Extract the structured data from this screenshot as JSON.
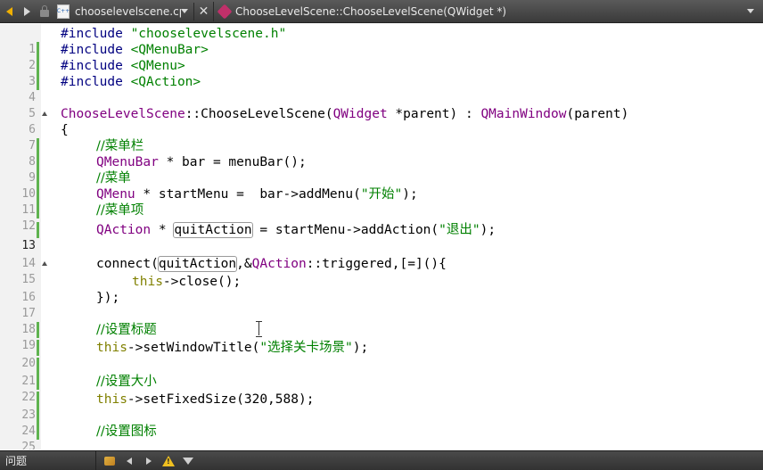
{
  "toolbar": {
    "file_name": "chooselevelscene.cpp",
    "symbol": "ChooseLevelScene::ChooseLevelScene(QWidget *)",
    "close_glyph": "✕",
    "file_icon_text": "C++"
  },
  "bottom_panel": {
    "title": "问题",
    "warning_glyph": "!"
  },
  "editor": {
    "current_line": 13,
    "lines": [
      {
        "n": "1"
      },
      {
        "n": "2"
      },
      {
        "n": "3"
      },
      {
        "n": "4"
      },
      {
        "n": "5"
      },
      {
        "n": "6"
      },
      {
        "n": "7"
      },
      {
        "n": "8"
      },
      {
        "n": "9"
      },
      {
        "n": "10"
      },
      {
        "n": "11"
      },
      {
        "n": "12"
      },
      {
        "n": "13"
      },
      {
        "n": "14"
      },
      {
        "n": "15"
      },
      {
        "n": "16"
      },
      {
        "n": "17"
      },
      {
        "n": "18"
      },
      {
        "n": "19"
      },
      {
        "n": "20"
      },
      {
        "n": "21"
      },
      {
        "n": "22"
      },
      {
        "n": "23"
      },
      {
        "n": "24"
      },
      {
        "n": "25"
      }
    ],
    "code": {
      "l1_a": "#include ",
      "l1_b": "\"chooselevelscene.h\"",
      "l2_a": "#include ",
      "l2_b": "<QMenuBar>",
      "l3_a": "#include ",
      "l3_b": "<QMenu>",
      "l4_a": "#include ",
      "l4_b": "<QAction>",
      "l6_a": "ChooseLevelScene",
      "l6_b": "::ChooseLevelScene(",
      "l6_c": "QWidget",
      "l6_d": " *parent) : ",
      "l6_e": "QMainWindow",
      "l6_f": "(parent)",
      "l7": "{",
      "l8": "//菜单栏",
      "l9_a": "QMenuBar",
      "l9_b": " * bar = menuBar();",
      "l10": "//菜单",
      "l11_a": "QMenu",
      "l11_b": " * startMenu =  bar->addMenu(",
      "l11_c": "\"开始\"",
      "l11_d": ");",
      "l12": "//菜单项",
      "l13_a": "QAction",
      "l13_b": " * ",
      "l13_c": "quitAction",
      "l13_d": " = startMenu->addAction(",
      "l13_e": "\"退出\"",
      "l13_f": ");",
      "l15_a": "connect(",
      "l15_b": "quitAction",
      "l15_c": ",&",
      "l15_d": "QAction",
      "l15_e": "::triggered,[=](){",
      "l16_a": "this",
      "l16_b": "->close();",
      "l17": "});",
      "l19": "//设置标题",
      "l20_a": "this",
      "l20_b": "->setWindowTitle(",
      "l20_c": "\"选择关卡场景\"",
      "l20_d": ");",
      "l22": "//设置大小",
      "l23_a": "this",
      "l23_b": "->setFixedSize(320,588);",
      "l25": "//设置图标"
    }
  }
}
